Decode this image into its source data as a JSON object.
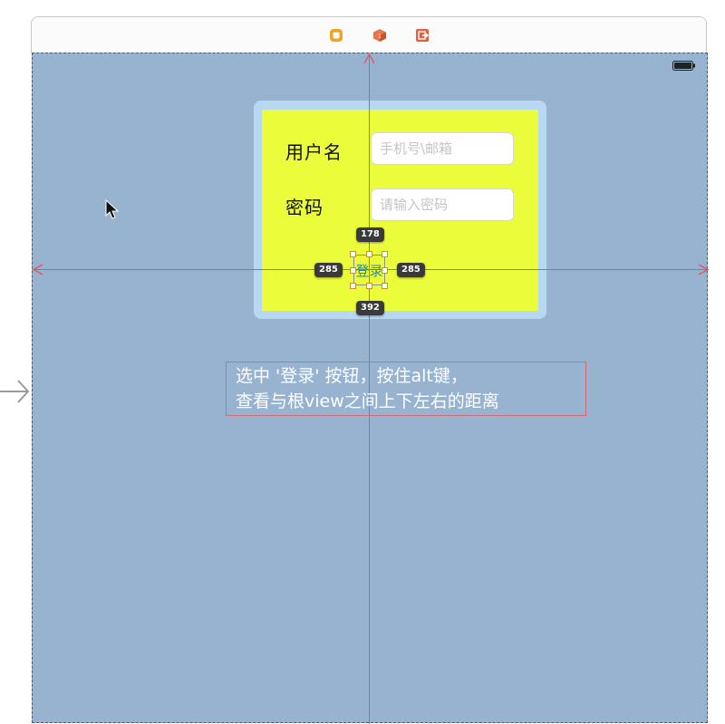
{
  "scene_dock": {
    "icons": [
      "view-controller-icon",
      "first-responder-icon",
      "exit-icon"
    ],
    "colors": {
      "controller": "#f0a324",
      "responder": "#e8744b",
      "exit": "#e85d3a"
    }
  },
  "form": {
    "username_label": "用户名",
    "username_placeholder": "手机号\\邮箱",
    "password_label": "密码",
    "password_placeholder": "请输入密码",
    "login_button": "登录"
  },
  "constraints": {
    "top": "178",
    "bottom": "392",
    "left": "285",
    "right": "285"
  },
  "annotation": {
    "line1": "选中 '登录' 按钮，按住alt键，",
    "line2": "查看与根view之间上下左右的距离"
  },
  "colors": {
    "canvas": "#97b3d0",
    "card_outer": "#b8d8f1",
    "card_inner": "#eafc3a",
    "guides": "#e0575f",
    "button_text": "#2d8b8e"
  }
}
